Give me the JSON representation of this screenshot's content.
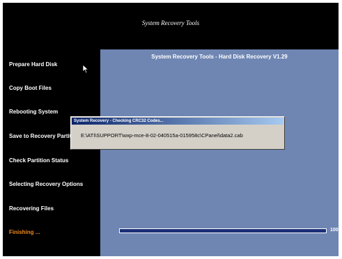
{
  "banner": {
    "title": "System Recovery Tools"
  },
  "sidebar": {
    "steps": [
      {
        "label": "Prepare Hard Disk",
        "state": "done"
      },
      {
        "label": "Copy Boot Files",
        "state": "done"
      },
      {
        "label": "Rebooting System",
        "state": "done"
      },
      {
        "label": "Save to Recovery Partition",
        "state": "done"
      },
      {
        "label": "Check Partition Status",
        "state": "done"
      },
      {
        "label": "Selecting Recovery Options",
        "state": "done"
      },
      {
        "label": "Recovering Files",
        "state": "done"
      },
      {
        "label": "Finishing ...",
        "state": "active"
      }
    ]
  },
  "main": {
    "title": "System Recovery Tools - Hard Disk Recovery V1.29",
    "progress": {
      "value": 100,
      "label": "100"
    }
  },
  "dialog": {
    "title": "System Recovery - Checking CRC32 Codes...",
    "path": "E:\\ATI\\SUPPORT\\wxp-mce-8-02-040515a-015958c\\CPanel\\data2.cab"
  },
  "colors": {
    "background": "#000000",
    "main_panel": "#6f86b3",
    "active_step": "#f08a1e",
    "progress_fill": "#1c2f78",
    "dialog_face": "#d4d0c8"
  },
  "icons": {
    "pointer": "arrow-cursor-icon"
  }
}
